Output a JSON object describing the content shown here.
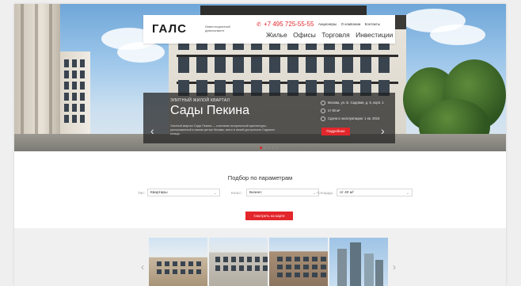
{
  "header": {
    "logo": "ГАЛС",
    "logo_sub": "Инвестиционный девелопмент",
    "phone": "+7 495 725-55-55",
    "top_links": [
      "Акционеры",
      "О компании",
      "Контакты"
    ],
    "nav": [
      "Жилье",
      "Офисы",
      "Торговля",
      "Инвестиции"
    ]
  },
  "slide": {
    "kicker": "ЭЛИТНЫЙ ЖИЛОЙ КВАРТАЛ",
    "title": "Сады Пекина",
    "description": "Элитный квартал Сады Пекина — сочетание исторической архитектуры, расположенный в самом центре Москвы, всего в пешей доступности Садового кольца.",
    "facts": [
      "Москва, ул. Б. Садовая, д. 5, корп. 1",
      "от 90 м²",
      "Сдача в эксплуатацию: 1 кв. 2015"
    ],
    "more_button": "Подробнее",
    "dots_total": 5,
    "dot_active": 1
  },
  "filter": {
    "title": "Подбор по параметрам",
    "type_label": "Тип:",
    "type_value": "Квартиры",
    "class_label": "Класс:",
    "class_value": "Бизнес",
    "area_label": "Площадь:",
    "area_value": "от 40 м²",
    "map_button": "Смотреть на карте"
  },
  "icons": {
    "phone": "phone-icon",
    "prev": "chevron-left-icon",
    "next": "chevron-right-icon"
  },
  "colors": {
    "accent": "#e3262b"
  }
}
